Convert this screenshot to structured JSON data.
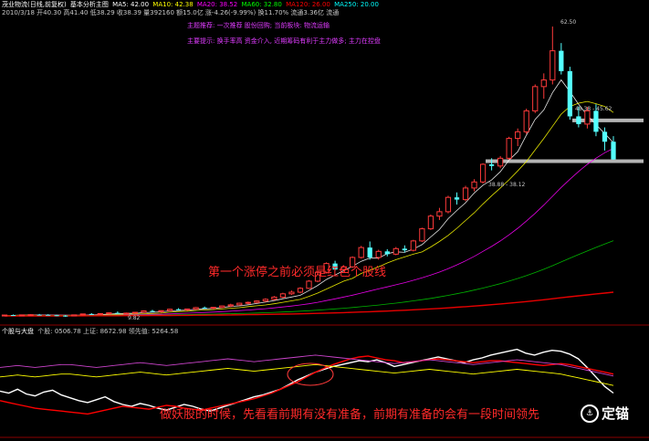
{
  "header": {
    "title": "茂业物流(日线,前复权)",
    "tab_label": "基本分析主图",
    "ma_labels": [
      "MA5: 42.00",
      "MA10: 42.38",
      "MA20: 38.52",
      "MA60: 32.80",
      "MA120: 26.00",
      "MA250: 20.00"
    ],
    "ma_colors": [
      "#ffffff",
      "#ffff00",
      "#ff00ff",
      "#00ff00",
      "#ff0000",
      "#00ffff"
    ],
    "quote_line": "2010/3/18 开40.30 高41.40 低38.29 收38.39 量392160 额15.0亿 涨-4.26(-9.99%) 换11.70% 流通3.36亿 流通",
    "notes": [
      "主题推荐: 一次推荐 股份回购; 当前板块: 物流运输",
      "主要提示: 换手率高 资金介入, 近期筹码有利于主力做多; 主力在控盘"
    ]
  },
  "price_axis": {
    "high_label": "62.50",
    "upper_zone_label": "48.38 - 45.62",
    "lower_zone_label": "38.88 - 38.12",
    "low_label": "9.82"
  },
  "annotations": {
    "main": "第一个涨停之前必须是红色个股线",
    "bottom": "做妖股的时候，先看看前期有没有准备，前期有准备的会有一段时间领先"
  },
  "sub_header": {
    "title": "个股与大盘",
    "text": "个股: 0506.78 上证: 8672.98 领先值: 5264.58"
  },
  "watermark": "定锚",
  "watermark_icon": "anchor-icon",
  "chart_data": {
    "type": "candlestick",
    "title": "茂业物流(日线,前复权)",
    "y_range": [
      9,
      64
    ],
    "candles": [
      [
        10.1,
        10.2,
        10.0,
        10.15
      ],
      [
        10.15,
        10.25,
        10.05,
        10.1
      ],
      [
        10.1,
        10.2,
        10.0,
        10.18
      ],
      [
        10.18,
        10.3,
        10.1,
        10.22
      ],
      [
        10.22,
        10.35,
        10.15,
        10.2
      ],
      [
        10.2,
        10.3,
        10.08,
        10.12
      ],
      [
        10.12,
        10.2,
        9.95,
        10.05
      ],
      [
        10.05,
        10.15,
        9.82,
        10.0
      ],
      [
        10.0,
        10.2,
        9.95,
        10.18
      ],
      [
        10.18,
        10.4,
        10.1,
        10.35
      ],
      [
        10.35,
        10.5,
        10.2,
        10.3
      ],
      [
        10.3,
        10.45,
        10.2,
        10.42
      ],
      [
        10.42,
        10.6,
        10.3,
        10.55
      ],
      [
        10.55,
        10.8,
        10.4,
        10.45
      ],
      [
        10.45,
        10.6,
        10.3,
        10.5
      ],
      [
        10.5,
        10.7,
        10.4,
        10.65
      ],
      [
        10.65,
        11.0,
        10.55,
        10.9
      ],
      [
        10.9,
        11.1,
        10.7,
        10.8
      ],
      [
        10.8,
        11.0,
        10.6,
        10.95
      ],
      [
        10.95,
        11.3,
        10.85,
        11.2
      ],
      [
        11.2,
        11.4,
        11.0,
        11.1
      ],
      [
        11.1,
        11.3,
        10.9,
        11.25
      ],
      [
        11.25,
        11.6,
        11.1,
        11.5
      ],
      [
        11.5,
        11.7,
        11.3,
        11.4
      ],
      [
        11.4,
        11.6,
        11.2,
        11.55
      ],
      [
        11.55,
        11.9,
        11.4,
        11.8
      ],
      [
        11.8,
        12.2,
        11.6,
        12.0
      ],
      [
        12.0,
        12.4,
        11.9,
        12.3
      ],
      [
        12.3,
        12.6,
        12.1,
        12.45
      ],
      [
        12.45,
        12.8,
        12.3,
        12.7
      ],
      [
        12.7,
        13.2,
        12.5,
        13.0
      ],
      [
        13.0,
        13.6,
        12.8,
        13.4
      ],
      [
        13.4,
        14.2,
        13.2,
        14.0
      ],
      [
        14.0,
        14.6,
        13.8,
        14.3
      ],
      [
        14.3,
        15.2,
        14.1,
        15.0
      ],
      [
        15.0,
        16.5,
        14.9,
        16.3
      ],
      [
        16.3,
        18.2,
        16.1,
        17.9
      ],
      [
        17.9,
        19.7,
        17.7,
        19.5
      ],
      [
        19.5,
        20.0,
        18.2,
        18.4
      ],
      [
        18.4,
        19.2,
        18.0,
        18.9
      ],
      [
        18.9,
        20.8,
        18.7,
        20.6
      ],
      [
        20.6,
        22.7,
        20.4,
        22.4
      ],
      [
        22.4,
        23.5,
        20.2,
        20.6
      ],
      [
        20.6,
        22.0,
        20.2,
        21.7
      ],
      [
        21.7,
        22.1,
        20.8,
        21.2
      ],
      [
        21.2,
        22.5,
        21.0,
        22.2
      ],
      [
        22.2,
        22.8,
        21.5,
        21.9
      ],
      [
        21.9,
        23.8,
        21.7,
        23.6
      ],
      [
        23.6,
        26.0,
        23.4,
        25.8
      ],
      [
        25.8,
        28.4,
        25.6,
        28.1
      ],
      [
        28.1,
        29.6,
        27.4,
        28.9
      ],
      [
        28.9,
        31.8,
        28.6,
        31.5
      ],
      [
        31.5,
        32.4,
        30.2,
        31.1
      ],
      [
        31.1,
        33.6,
        30.8,
        33.2
      ],
      [
        33.2,
        34.8,
        32.6,
        34.3
      ],
      [
        34.3,
        37.7,
        34.0,
        37.5
      ],
      [
        37.5,
        38.6,
        36.4,
        37.2
      ],
      [
        37.2,
        39.0,
        36.8,
        38.6
      ],
      [
        38.6,
        42.5,
        38.3,
        42.2
      ],
      [
        42.2,
        44.0,
        40.8,
        43.4
      ],
      [
        43.4,
        47.6,
        43.0,
        47.2
      ],
      [
        47.2,
        52.0,
        46.8,
        51.6
      ],
      [
        51.6,
        54.0,
        49.4,
        52.8
      ],
      [
        52.8,
        62.5,
        52.0,
        58.1
      ],
      [
        58.1,
        59.5,
        53.8,
        54.4
      ],
      [
        54.4,
        55.2,
        45.6,
        46.2
      ],
      [
        46.2,
        48.0,
        44.2,
        44.8
      ],
      [
        44.8,
        47.9,
        44.0,
        47.2
      ],
      [
        47.2,
        48.4,
        42.6,
        43.4
      ],
      [
        43.4,
        44.2,
        40.0,
        41.6
      ],
      [
        41.6,
        42.6,
        38.3,
        38.4
      ]
    ],
    "ma_series": [
      {
        "name": "MA5",
        "color": "#ffffff",
        "values": [
          10.1,
          10.1,
          10.12,
          10.15,
          10.17,
          10.16,
          10.13,
          10.1,
          10.07,
          10.11,
          10.17,
          10.25,
          10.32,
          10.41,
          10.45,
          10.47,
          10.59,
          10.66,
          10.74,
          10.9,
          10.99,
          11.06,
          11.2,
          11.29,
          11.36,
          11.52,
          11.71,
          11.81,
          12.02,
          12.25,
          12.49,
          12.77,
          13.11,
          13.43,
          13.74,
          14.6,
          15.52,
          16.6,
          17.42,
          18.21,
          18.99,
          19.9,
          20.5,
          20.48,
          21.3,
          21.62,
          21.52,
          22.12,
          22.94,
          24.32,
          25.66,
          27.64,
          29.12,
          30.52,
          32.3,
          33.72,
          34.66,
          36.16,
          38.28,
          39.78,
          42.8,
          45.64,
          47.36,
          50.52,
          52.82,
          50.66,
          48.4,
          46.4,
          44.7,
          43.1,
          41.4
        ]
      },
      {
        "name": "MA10",
        "color": "#ffff00",
        "values": [
          10.1,
          10.1,
          10.11,
          10.13,
          10.14,
          10.14,
          10.13,
          10.12,
          10.11,
          10.13,
          10.14,
          10.16,
          10.21,
          10.27,
          10.31,
          10.32,
          10.36,
          10.42,
          10.5,
          10.67,
          10.79,
          10.86,
          10.97,
          11.07,
          11.13,
          11.25,
          11.38,
          11.48,
          11.68,
          11.83,
          11.99,
          12.2,
          12.47,
          12.72,
          13.0,
          13.54,
          14.14,
          14.86,
          15.59,
          16.31,
          16.8,
          17.7,
          18.3,
          18.9,
          19.6,
          20.2,
          20.7,
          21.2,
          21.6,
          22.5,
          23.5,
          24.6,
          25.9,
          27.3,
          28.7,
          30.3,
          31.8,
          33.2,
          34.7,
          36.3,
          38.0,
          40.1,
          42.2,
          44.4,
          46.6,
          48.0,
          48.6,
          48.9,
          48.5,
          48.0,
          46.9
        ]
      },
      {
        "name": "MA20",
        "color": "#ff00ff",
        "values": [
          10.1,
          10.1,
          10.1,
          10.11,
          10.12,
          10.12,
          10.12,
          10.12,
          10.11,
          10.12,
          10.12,
          10.13,
          10.15,
          10.18,
          10.2,
          10.22,
          10.24,
          10.27,
          10.31,
          10.36,
          10.43,
          10.49,
          10.55,
          10.62,
          10.69,
          10.77,
          10.86,
          10.95,
          11.05,
          11.18,
          11.31,
          11.45,
          11.61,
          11.79,
          11.98,
          12.2,
          12.46,
          12.77,
          13.1,
          13.43,
          13.76,
          14.13,
          14.51,
          14.89,
          15.27,
          15.65,
          16.03,
          16.45,
          16.9,
          17.4,
          17.95,
          18.58,
          19.25,
          19.98,
          20.8,
          21.7,
          22.6,
          23.6,
          24.7,
          25.9,
          27.2,
          28.6,
          30.1,
          31.7,
          33.3,
          34.8,
          36.2,
          37.5,
          38.6,
          39.6,
          40.4
        ]
      },
      {
        "name": "MA60",
        "color": "#00c800",
        "values": [
          10.1,
          10.1,
          10.1,
          10.1,
          10.1,
          10.1,
          10.1,
          10.1,
          10.1,
          10.1,
          10.1,
          10.11,
          10.11,
          10.12,
          10.13,
          10.14,
          10.15,
          10.16,
          10.18,
          10.2,
          10.22,
          10.24,
          10.27,
          10.3,
          10.33,
          10.36,
          10.4,
          10.44,
          10.48,
          10.53,
          10.58,
          10.64,
          10.7,
          10.77,
          10.85,
          10.94,
          11.04,
          11.15,
          11.27,
          11.39,
          11.52,
          11.66,
          11.81,
          11.97,
          12.14,
          12.32,
          12.51,
          12.72,
          12.94,
          13.18,
          13.44,
          13.72,
          14.02,
          14.34,
          14.68,
          15.05,
          15.44,
          15.85,
          16.3,
          16.78,
          17.3,
          17.86,
          18.46,
          19.1,
          19.78,
          20.46,
          21.12,
          21.78,
          22.42,
          23.04,
          23.64
        ]
      },
      {
        "name": "MA120",
        "color": "#ff0000",
        "values": [
          10.0,
          10.0,
          10.0,
          10.0,
          10.0,
          10.0,
          10.0,
          10.01,
          10.01,
          10.01,
          10.02,
          10.02,
          10.03,
          10.03,
          10.04,
          10.05,
          10.05,
          10.06,
          10.07,
          10.08,
          10.09,
          10.1,
          10.12,
          10.13,
          10.15,
          10.16,
          10.18,
          10.2,
          10.22,
          10.24,
          10.27,
          10.29,
          10.32,
          10.35,
          10.38,
          10.42,
          10.46,
          10.5,
          10.54,
          10.59,
          10.64,
          10.7,
          10.76,
          10.82,
          10.88,
          10.95,
          11.02,
          11.1,
          11.18,
          11.27,
          11.36,
          11.46,
          11.56,
          11.67,
          11.78,
          11.9,
          12.03,
          12.16,
          12.3,
          12.45,
          12.6,
          12.76,
          12.93,
          13.11,
          13.29,
          13.47,
          13.64,
          13.81,
          13.98,
          14.14,
          14.3
        ]
      }
    ],
    "sub_series": [
      {
        "name": "个股",
        "color": "#ffffff",
        "values": [
          40,
          38,
          42,
          37,
          35,
          39,
          41,
          36,
          33,
          30,
          28,
          31,
          34,
          29,
          26,
          24,
          27,
          25,
          22,
          20,
          23,
          26,
          24,
          21,
          19,
          22,
          25,
          28,
          31,
          34,
          36,
          39,
          42,
          47,
          52,
          56,
          60,
          63,
          66,
          68,
          70,
          72,
          71,
          73,
          70,
          66,
          68,
          70,
          72,
          74,
          76,
          74,
          72,
          70,
          73,
          75,
          78,
          80,
          82,
          84,
          80,
          78,
          81,
          83,
          82,
          79,
          74,
          65,
          55,
          45,
          38
        ]
      },
      {
        "name": "上证",
        "color": "#ff0000",
        "values": [
          30,
          28,
          26,
          24,
          22,
          21,
          20,
          19,
          18,
          17,
          16,
          18,
          20,
          22,
          24,
          23,
          22,
          21,
          23,
          25,
          24,
          22,
          21,
          20,
          22,
          24,
          26,
          28,
          30,
          32,
          35,
          38,
          42,
          46,
          50,
          55,
          60,
          64,
          68,
          71,
          74,
          76,
          77,
          75,
          73,
          72,
          70,
          71,
          72,
          73,
          74,
          73,
          72,
          71,
          70,
          71,
          72,
          72,
          71,
          70,
          69,
          68,
          67,
          68,
          69,
          68,
          66,
          64,
          62,
          60,
          58
        ]
      },
      {
        "name": "领先值",
        "color": "#ffff00",
        "values": [
          55,
          56,
          57,
          56,
          55,
          56,
          57,
          58,
          58,
          57,
          56,
          55,
          56,
          57,
          58,
          59,
          60,
          59,
          58,
          57,
          58,
          59,
          60,
          61,
          62,
          63,
          64,
          63,
          62,
          61,
          62,
          63,
          64,
          65,
          66,
          67,
          68,
          67,
          66,
          65,
          64,
          63,
          62,
          61,
          60,
          59,
          60,
          61,
          62,
          63,
          62,
          61,
          60,
          59,
          58,
          59,
          60,
          61,
          62,
          63,
          62,
          61,
          60,
          59,
          58,
          56,
          54,
          52,
          50,
          48,
          46
        ]
      },
      {
        "name": "个股强度",
        "color": "#cc44cc",
        "values": [
          65,
          66,
          67,
          66,
          65,
          66,
          67,
          68,
          68,
          67,
          66,
          65,
          66,
          67,
          68,
          69,
          70,
          69,
          68,
          67,
          68,
          69,
          70,
          71,
          72,
          73,
          74,
          73,
          72,
          71,
          72,
          73,
          74,
          75,
          76,
          77,
          78,
          77,
          76,
          75,
          74,
          73,
          72,
          71,
          70,
          69,
          70,
          71,
          72,
          73,
          72,
          71,
          70,
          69,
          68,
          69,
          70,
          71,
          72,
          73,
          72,
          71,
          70,
          69,
          68,
          66,
          64,
          62,
          60,
          58,
          56
        ]
      }
    ]
  }
}
